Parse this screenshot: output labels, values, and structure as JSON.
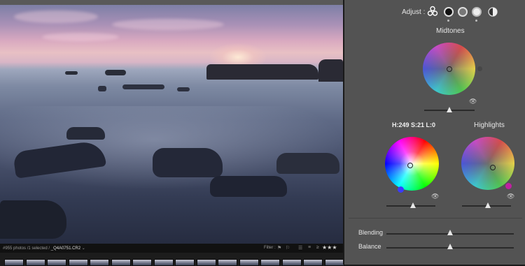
{
  "statusbar": {
    "count_text": "#955 photos /1 selected /",
    "filename": "_Q4A0751.CR2",
    "filename_suffix": " ⌄",
    "filter_label": "Filter :",
    "stars": "★★★"
  },
  "filmstrip": {
    "thumb_count": 16
  },
  "panel": {
    "adjust_label": "Adjust :",
    "midtones_title": "Midtones",
    "shadows_readout": "H:249 S:21 L:0",
    "highlights_title": "Highlights",
    "blending_label": "Blending",
    "balance_label": "Balance"
  },
  "sliders": {
    "midtones_luminance": 0.5,
    "shadows_luminance": 0.5,
    "highlights_luminance": 0.5,
    "blending": 0.5,
    "balance": 0.5
  },
  "colors": {
    "panel_bg": "#535353",
    "shadows_knob": "#3b3bff",
    "highlights_knob": "#c020a0",
    "midtones_knob": "#5a5a5a"
  }
}
